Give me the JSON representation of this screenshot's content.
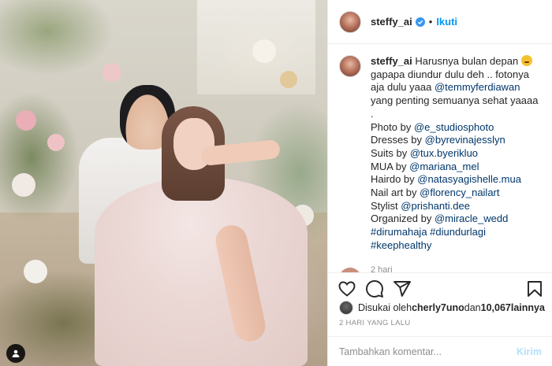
{
  "post": {
    "account": {
      "username": "steffy_ai",
      "verified": true,
      "follow_label": "Ikuti",
      "separator": "•"
    },
    "caption": {
      "username": "steffy_ai",
      "text_1": " Harusnya bulan depan ",
      "emoji": "crying-face",
      "text_2": " gapapa diundur dulu deh .. fotonya aja dulu yaaa ",
      "mention_partner": "@temmyferdiawan",
      "text_3": " yang penting semuanya sehat yaaaa",
      "dot": ".",
      "credits": [
        {
          "label": "Photo by ",
          "handle": "@e_studiosphoto"
        },
        {
          "label": "Dresses by ",
          "handle": "@byrevinajesslyn"
        },
        {
          "label": "Suits by ",
          "handle": "@tux.byerikluo"
        },
        {
          "label": "MUA by ",
          "handle": "@mariana_mel"
        },
        {
          "label": "Hairdo by ",
          "handle": "@natasyagishelle.mua"
        },
        {
          "label": "Nail art by ",
          "handle": "@florency_nailart"
        },
        {
          "label": "Stylist ",
          "handle": "@prishanti.dee"
        },
        {
          "label": "Organized by ",
          "handle": "@miracle_wedd"
        }
      ],
      "hashtags_line1": "#dirumahaja #diundurlagi",
      "hashtags_line2": "#keephealthy",
      "time": "2 hari"
    },
    "actions": {
      "like_icon": "heart-icon",
      "comment_icon": "comment-icon",
      "share_icon": "share-icon",
      "save_icon": "bookmark-icon"
    },
    "likes": {
      "prefix": "Disukai oleh ",
      "user": "cherly7uno",
      "middle": " dan ",
      "count": "10,067",
      "suffix": " lainnya"
    },
    "posted_ago": "2 HARI YANG LALU",
    "comment_box": {
      "placeholder": "Tambahkan komentar...",
      "send_label": "Kirim"
    }
  },
  "colors": {
    "link": "#00376b",
    "follow": "#0095f6",
    "send_disabled": "#b2dffc",
    "muted": "#8e8e8e"
  }
}
